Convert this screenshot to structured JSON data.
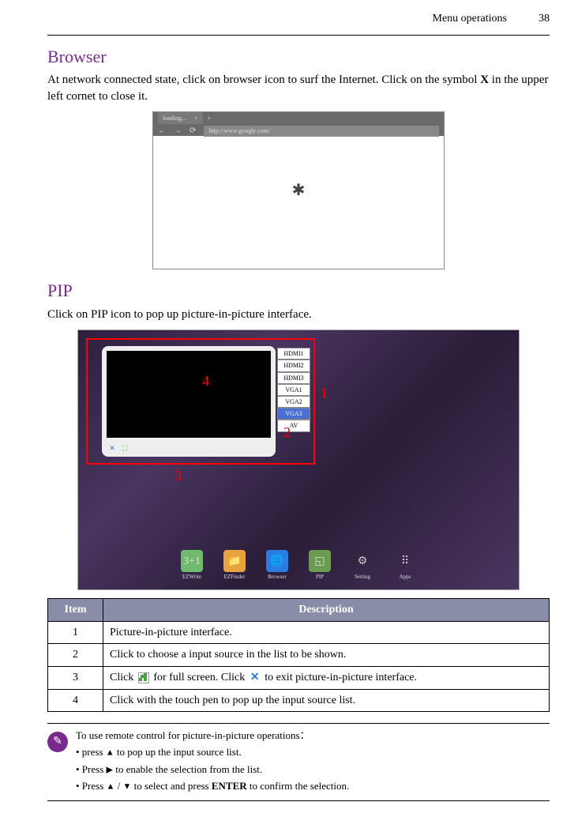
{
  "header": {
    "title": "Menu operations",
    "page": "38"
  },
  "browser": {
    "heading": "Browser",
    "desc_p1": "At network connected state, click on browser icon to surf the Internet. Click on the symbol ",
    "desc_bold": "X",
    "desc_p2": " in the upper left cornet to close it.",
    "tab": "loading...",
    "url": "http://www.google.com/"
  },
  "pip": {
    "heading": "PIP",
    "desc": "Click on PIP icon to pop up picture-in-picture interface.",
    "sources": [
      "HDMI1",
      "HDMI2",
      "HDMI3",
      "VGA1",
      "VGA2",
      "VGA3",
      "AV"
    ],
    "callouts": {
      "c1": "1",
      "c2": "2",
      "c3": "3",
      "c4": "4"
    },
    "dock": [
      {
        "label": "EZWrite",
        "icon": "3+1",
        "bg": "#6fba6f"
      },
      {
        "label": "EZFinder",
        "icon": "📁",
        "bg": "#e6a340"
      },
      {
        "label": "Browser",
        "icon": "🌐",
        "bg": "#2a7de1"
      },
      {
        "label": "PIP",
        "icon": "◱",
        "bg": "#6b9b4f"
      },
      {
        "label": "Setting",
        "icon": "⚙",
        "bg": "#888"
      },
      {
        "label": "Apps",
        "icon": "⠿",
        "bg": "transparent"
      }
    ]
  },
  "table": {
    "headers": [
      "Item",
      "Description"
    ],
    "rows": [
      {
        "item": "1",
        "desc_full": "Picture-in-picture interface."
      },
      {
        "item": "2",
        "desc_full": "Click to choose a input source in the list to be shown."
      },
      {
        "item": "3",
        "desc_p1": "Click ",
        "desc_p2": " for full screen. Click ",
        "desc_p3": " to exit picture-in-picture interface."
      },
      {
        "item": "4",
        "desc_full": "Click with the touch pen to pop up the input source list."
      }
    ]
  },
  "note": {
    "line1": "To use remote control for picture-in-picture operations：",
    "line2a": "• press ",
    "line2b": " to pop up the input source list.",
    "line3a": "• Press ",
    "line3b": " to enable the selection from the list.",
    "line4a": "• Press ",
    "line4b": " / ",
    "line4c": " to select and press ",
    "line4bold": "ENTER",
    "line4d": " to confirm the selection."
  }
}
